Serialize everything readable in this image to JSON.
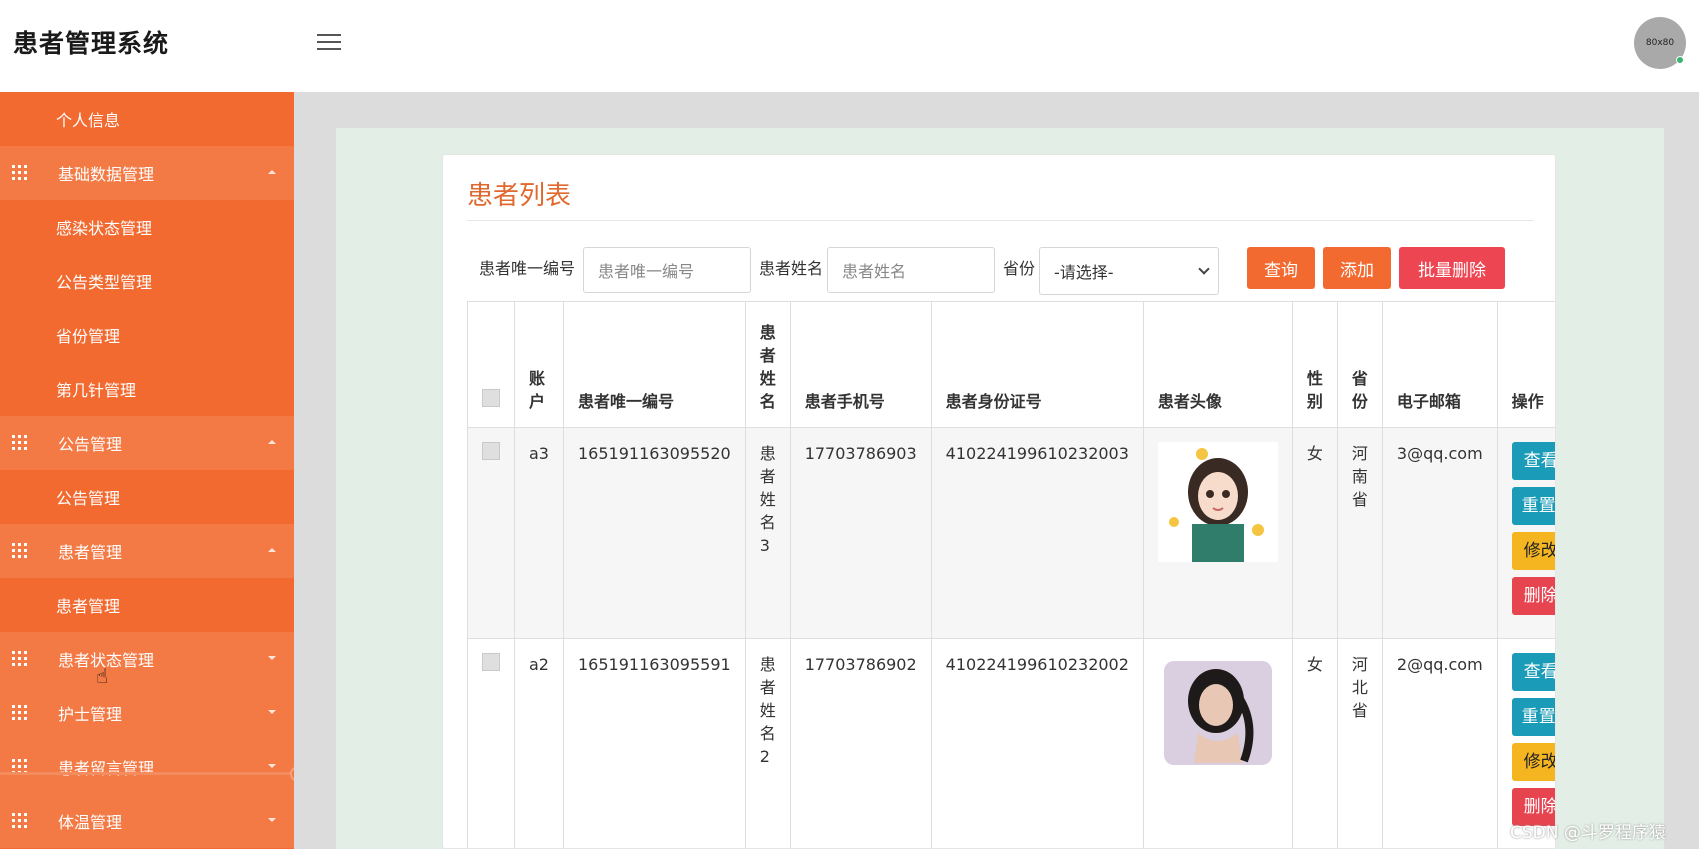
{
  "app": {
    "title": "患者管理系统",
    "avatar_text": "80x80"
  },
  "sidebar": {
    "items": [
      {
        "label": "个人信息",
        "type": "sub"
      },
      {
        "label": "基础数据管理",
        "type": "group",
        "expanded": true
      },
      {
        "label": "感染状态管理",
        "type": "sub"
      },
      {
        "label": "公告类型管理",
        "type": "sub"
      },
      {
        "label": "省份管理",
        "type": "sub"
      },
      {
        "label": "第几针管理",
        "type": "sub"
      },
      {
        "label": "公告管理",
        "type": "group",
        "expanded": true
      },
      {
        "label": "公告管理",
        "type": "sub"
      },
      {
        "label": "患者管理",
        "type": "group",
        "expanded": true
      },
      {
        "label": "患者管理",
        "type": "sub"
      },
      {
        "label": "患者状态管理",
        "type": "group",
        "expanded": false
      },
      {
        "label": "护士管理",
        "type": "group",
        "expanded": false
      },
      {
        "label": "患者留言管理",
        "type": "group",
        "expanded": false
      },
      {
        "label": "体温管理",
        "type": "group",
        "expanded": false
      }
    ]
  },
  "page": {
    "title": "患者列表"
  },
  "search": {
    "uid_label": "患者唯一编号",
    "uid_placeholder": "患者唯一编号",
    "name_label": "患者姓名",
    "name_placeholder": "患者姓名",
    "province_label": "省份",
    "province_value": "-请选择-",
    "query_button": "查询",
    "add_button": "添加",
    "batch_delete_button": "批量删除"
  },
  "table": {
    "headers": {
      "account": "账户",
      "uid": "患者唯一编号",
      "name": "患者姓名",
      "phone": "患者手机号",
      "idcard": "患者身份证号",
      "photo": "患者头像",
      "gender": "性别",
      "province": "省份",
      "email": "电子邮箱",
      "actions": "操作"
    },
    "rows": [
      {
        "account": "a3",
        "uid": "165191163095520",
        "name": "患者姓名3",
        "phone": "17703786903",
        "idcard": "410224199610232003",
        "gender": "女",
        "province": "河南省",
        "email": "3@qq.com"
      },
      {
        "account": "a2",
        "uid": "165191163095591",
        "name": "患者姓名2",
        "phone": "17703786902",
        "idcard": "410224199610232002",
        "gender": "女",
        "province": "河北省",
        "email": "2@qq.com"
      }
    ],
    "action_labels": {
      "view": "查看",
      "reset": "重置密",
      "edit": "修改",
      "delete": "删除"
    }
  },
  "watermark": "CSDN @斗罗程序猿",
  "colors": {
    "accent": "#f26a30",
    "title": "#e0692f",
    "info": "#1a9bb8",
    "warning": "#f4b521",
    "danger": "#e64550"
  }
}
